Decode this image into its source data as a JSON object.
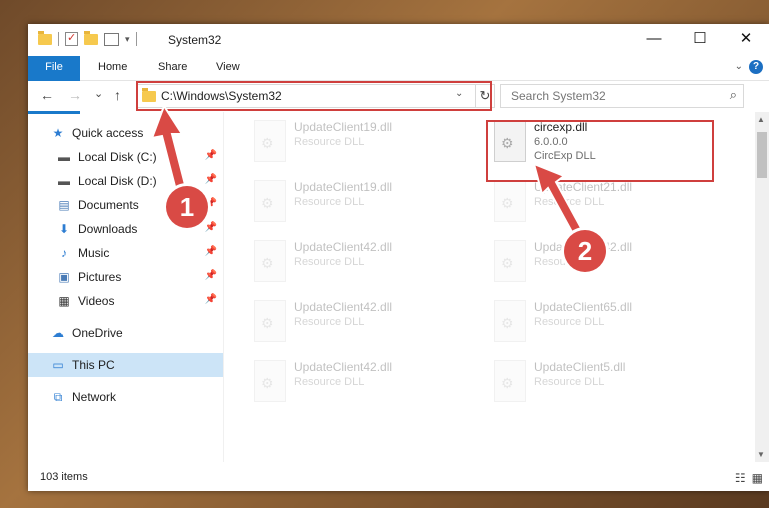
{
  "window": {
    "title": "System32",
    "controls": {
      "minimize": "—",
      "maximize": "☐",
      "close": "✕"
    }
  },
  "ribbon": {
    "tabs": [
      "File",
      "Home",
      "Share",
      "View"
    ],
    "help": "?"
  },
  "nav": {
    "back": "←",
    "forward": "→",
    "recent": "⌄",
    "up": "↑",
    "address": "C:\\Windows\\System32",
    "search_placeholder": "Search System32"
  },
  "sidebar": {
    "items": [
      {
        "label": "Quick access",
        "icon": "star-icon",
        "pinned": false
      },
      {
        "label": "Local Disk (C:)",
        "icon": "drive-icon",
        "pinned": true
      },
      {
        "label": "Local Disk (D:)",
        "icon": "drive-icon",
        "pinned": true
      },
      {
        "label": "Documents",
        "icon": "document-icon",
        "pinned": true
      },
      {
        "label": "Downloads",
        "icon": "download-icon",
        "pinned": true
      },
      {
        "label": "Music",
        "icon": "music-icon",
        "pinned": true
      },
      {
        "label": "Pictures",
        "icon": "pictures-icon",
        "pinned": true
      },
      {
        "label": "Videos",
        "icon": "video-icon",
        "pinned": true
      },
      {
        "label": "OneDrive",
        "icon": "cloud-icon",
        "pinned": false
      },
      {
        "label": "This PC",
        "icon": "computer-icon",
        "pinned": false
      },
      {
        "label": "Network",
        "icon": "network-icon",
        "pinned": false
      }
    ]
  },
  "files": [
    {
      "name": "UpdateClient19.dll",
      "line2": "Resource DLL",
      "line3": ""
    },
    {
      "name": "circexp.dll",
      "line2": "6.0.0.0",
      "line3": "CircExp DLL"
    },
    {
      "name": "UpdateClient19.dll",
      "line2": "Resource DLL",
      "line3": ""
    },
    {
      "name": "UpdateClient21.dll",
      "line2": "Resource DLL",
      "line3": ""
    },
    {
      "name": "UpdateClient42.dll",
      "line2": "Resource DLL",
      "line3": ""
    },
    {
      "name": "UpdateClient42.dll",
      "line2": "Resource DLL",
      "line3": ""
    },
    {
      "name": "UpdateClient42.dll",
      "line2": "Resource DLL",
      "line3": ""
    },
    {
      "name": "UpdateClient65.dll",
      "line2": "Resource DLL",
      "line3": ""
    },
    {
      "name": "UpdateClient42.dll",
      "line2": "Resource DLL",
      "line3": ""
    },
    {
      "name": "UpdateClient5.dll",
      "line2": "Resource DLL",
      "line3": ""
    }
  ],
  "status": {
    "count": "103 items"
  },
  "annotations": {
    "badge1": "1",
    "badge2": "2"
  },
  "colors": {
    "accent": "#1979ca",
    "highlight": "#cf3f3d",
    "selected": "#cce4f7"
  }
}
